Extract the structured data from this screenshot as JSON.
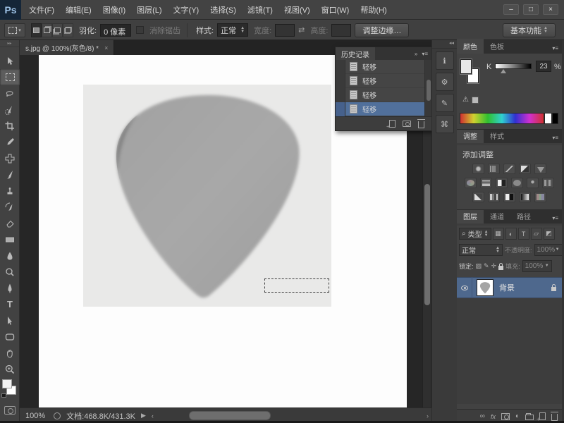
{
  "window": {
    "logo": "Ps",
    "minimize": "–",
    "maximize": "□",
    "close": "×"
  },
  "menu": {
    "items": [
      "文件(F)",
      "编辑(E)",
      "图像(I)",
      "图层(L)",
      "文字(Y)",
      "选择(S)",
      "滤镜(T)",
      "视图(V)",
      "窗口(W)",
      "帮助(H)"
    ]
  },
  "options": {
    "feather_label": "羽化:",
    "feather_value": "0 像素",
    "antialias_label": "消除锯齿",
    "style_label": "样式:",
    "style_value": "正常",
    "width_label": "宽度:",
    "width_value": "",
    "height_label": "高度:",
    "height_value": "",
    "refine_edge_label": "调整边缘…",
    "workspace_label": "基本功能"
  },
  "toolbar": {
    "tools": [
      "move",
      "marquee",
      "lasso",
      "quickselect",
      "crop",
      "eyedropper",
      "healing",
      "brush",
      "stamp",
      "historybrush",
      "eraser",
      "gradient",
      "blur",
      "dodge",
      "pen",
      "type",
      "pathselect",
      "shape",
      "hand",
      "zoomtool"
    ],
    "selected": "marquee"
  },
  "document": {
    "tab_title": "s.jpg @ 100%(灰色/8) *",
    "close": "×"
  },
  "history": {
    "title": "历史记录",
    "items": [
      {
        "label": "轻移"
      },
      {
        "label": "轻移"
      },
      {
        "label": "轻移"
      },
      {
        "label": "轻移"
      }
    ],
    "selected_index": 3
  },
  "color_panel": {
    "tabs": [
      "颜色",
      "色板"
    ],
    "channel_label": "K",
    "value": "23",
    "percent": "%"
  },
  "adjust_panel": {
    "tabs": [
      "调整",
      "样式"
    ],
    "add_label": "添加调整",
    "rows": [
      [
        "sun",
        "levels",
        "curves",
        "expo",
        "vib"
      ],
      [
        "hue",
        "cb",
        "bw",
        "pf",
        "cm",
        "clut"
      ],
      [
        "inv",
        "post",
        "thr",
        "gmap",
        "sel"
      ]
    ]
  },
  "layers_panel": {
    "tabs": [
      "图层",
      "通道",
      "路径"
    ],
    "filter_label": "类型",
    "blend_mode": "正常",
    "opacity_label": "不透明度:",
    "opacity_value": "100%",
    "lock_label": "锁定:",
    "fill_label": "填充:",
    "fill_value": "100%",
    "layer_name": "背景"
  },
  "status": {
    "zoom": "100%",
    "doc_info": "文档:468.8K/431.3K"
  },
  "canvas": {
    "selection": "rectangular-selection"
  }
}
